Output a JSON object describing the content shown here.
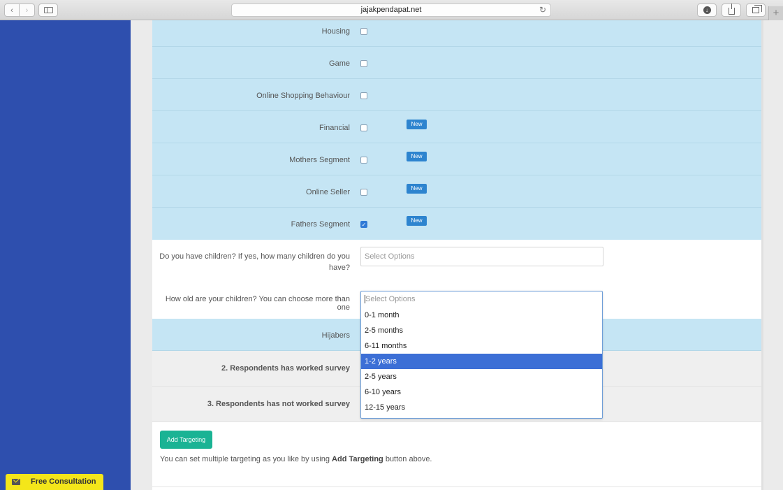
{
  "browser": {
    "url": "jajakpendapat.net",
    "reload_icon": "reload-icon",
    "nav_back": "‹",
    "nav_forward": "›",
    "plus": "+"
  },
  "segments": [
    {
      "label": "Housing",
      "checked": false,
      "badge": ""
    },
    {
      "label": "Game",
      "checked": false,
      "badge": ""
    },
    {
      "label": "Online Shopping Behaviour",
      "checked": false,
      "badge": ""
    },
    {
      "label": "Financial",
      "checked": false,
      "badge": "New"
    },
    {
      "label": "Mothers Segment",
      "checked": false,
      "badge": "New"
    },
    {
      "label": "Online Seller",
      "checked": false,
      "badge": "New"
    },
    {
      "label": "Fathers Segment",
      "checked": true,
      "badge": "New"
    }
  ],
  "questions": {
    "children_count": {
      "label": "Do you have children? If yes, how many children do you have?",
      "placeholder": "Select Options"
    },
    "children_age": {
      "label": "How old are your children? You can choose more than one",
      "placeholder": "Select Options",
      "options": [
        "0-1 month",
        "2-5 months",
        "6-11 months",
        "1-2 years",
        "2-5 years",
        "6-10 years",
        "12-15 years"
      ],
      "highlighted": "1-2 years"
    }
  },
  "hijabers": {
    "label": "Hijabers"
  },
  "sections": {
    "worked": "2. Respondents has worked survey",
    "not_worked": "3. Respondents has not worked survey"
  },
  "actions": {
    "add_targeting": "Add Targeting",
    "help_prefix": "You can set multiple targeting as you like by using ",
    "help_bold": "Add Targeting",
    "help_suffix": " button above."
  },
  "consultation": {
    "label": "Free Consultation"
  },
  "colors": {
    "sidebar": "#2e4fae",
    "segment_bg": "#c5e5f4",
    "badge": "#2d84cf",
    "dropdown_highlight": "#3c6fd6",
    "add_button": "#1ab394",
    "consult_bg": "#f4e61a"
  }
}
